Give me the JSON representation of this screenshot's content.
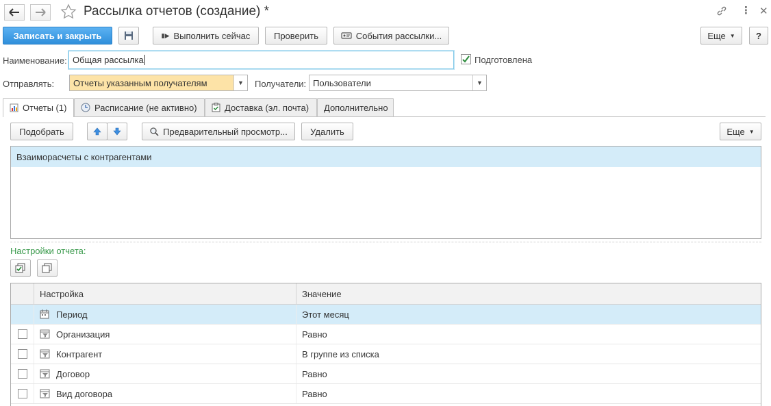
{
  "window": {
    "title": "Рассылка отчетов (создание) *"
  },
  "toolbar": {
    "save_close": "Записать и закрыть",
    "run_now": "Выполнить сейчас",
    "check": "Проверить",
    "events": "События рассылки...",
    "more": "Еще",
    "help": "?"
  },
  "form": {
    "name_label": "Наименование:",
    "name_value": "Общая рассылка",
    "prepared_label": "Подготовлена",
    "send_label": "Отправлять:",
    "send_value": "Отчеты указанным получателям",
    "recipients_label": "Получатели:",
    "recipients_value": "Пользователи"
  },
  "tabs": [
    {
      "label": "Отчеты (1)"
    },
    {
      "label": "Расписание (не активно)"
    },
    {
      "label": "Доставка (эл. почта)"
    },
    {
      "label": "Дополнительно"
    }
  ],
  "reports_toolbar": {
    "pick": "Подобрать",
    "preview": "Предварительный просмотр...",
    "delete": "Удалить",
    "more": "Еще"
  },
  "reports": [
    {
      "name": "Взаиморасчеты с контрагентами"
    }
  ],
  "settings": {
    "section_label": "Настройки отчета:",
    "columns": {
      "setting": "Настройка",
      "value": "Значение"
    },
    "rows": [
      {
        "setting": "Период",
        "value": "Этот месяц"
      },
      {
        "setting": "Организация",
        "value": "Равно"
      },
      {
        "setting": "Контрагент",
        "value": "В группе из списка"
      },
      {
        "setting": "Договор",
        "value": "Равно"
      },
      {
        "setting": "Вид договора",
        "value": "Равно"
      }
    ]
  },
  "colors": {
    "primary": "#2f8fdb",
    "selection": "#d4ecf9",
    "required_field": "#fde3a7",
    "section_label": "#3a9a4c"
  },
  "icons": {
    "back": "arrow-left-icon",
    "forward": "arrow-right-icon",
    "favorite": "star-icon",
    "link": "link-icon",
    "menu": "more-vertical-icon",
    "close": "close-icon"
  }
}
